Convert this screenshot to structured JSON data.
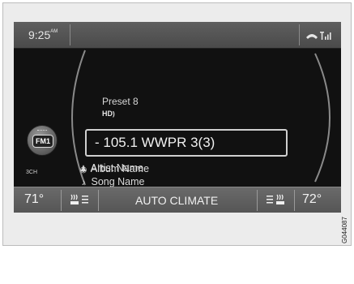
{
  "statusbar": {
    "time": "9:25",
    "ampm": "AM",
    "icons": [
      "phone-icon",
      "signal-icon"
    ]
  },
  "source": {
    "badge": "FM1",
    "channel": "3CH"
  },
  "radio": {
    "preset": "Preset 8",
    "hd": "HD",
    "station": "- 105.1 WWPR 3(3)",
    "artist": "Artist Name",
    "song": "Song Name",
    "album": "Album Name"
  },
  "climate": {
    "temp_left": "71°",
    "temp_right": "72°",
    "mode": "AUTO CLIMATE"
  },
  "figure_code": "G044087"
}
